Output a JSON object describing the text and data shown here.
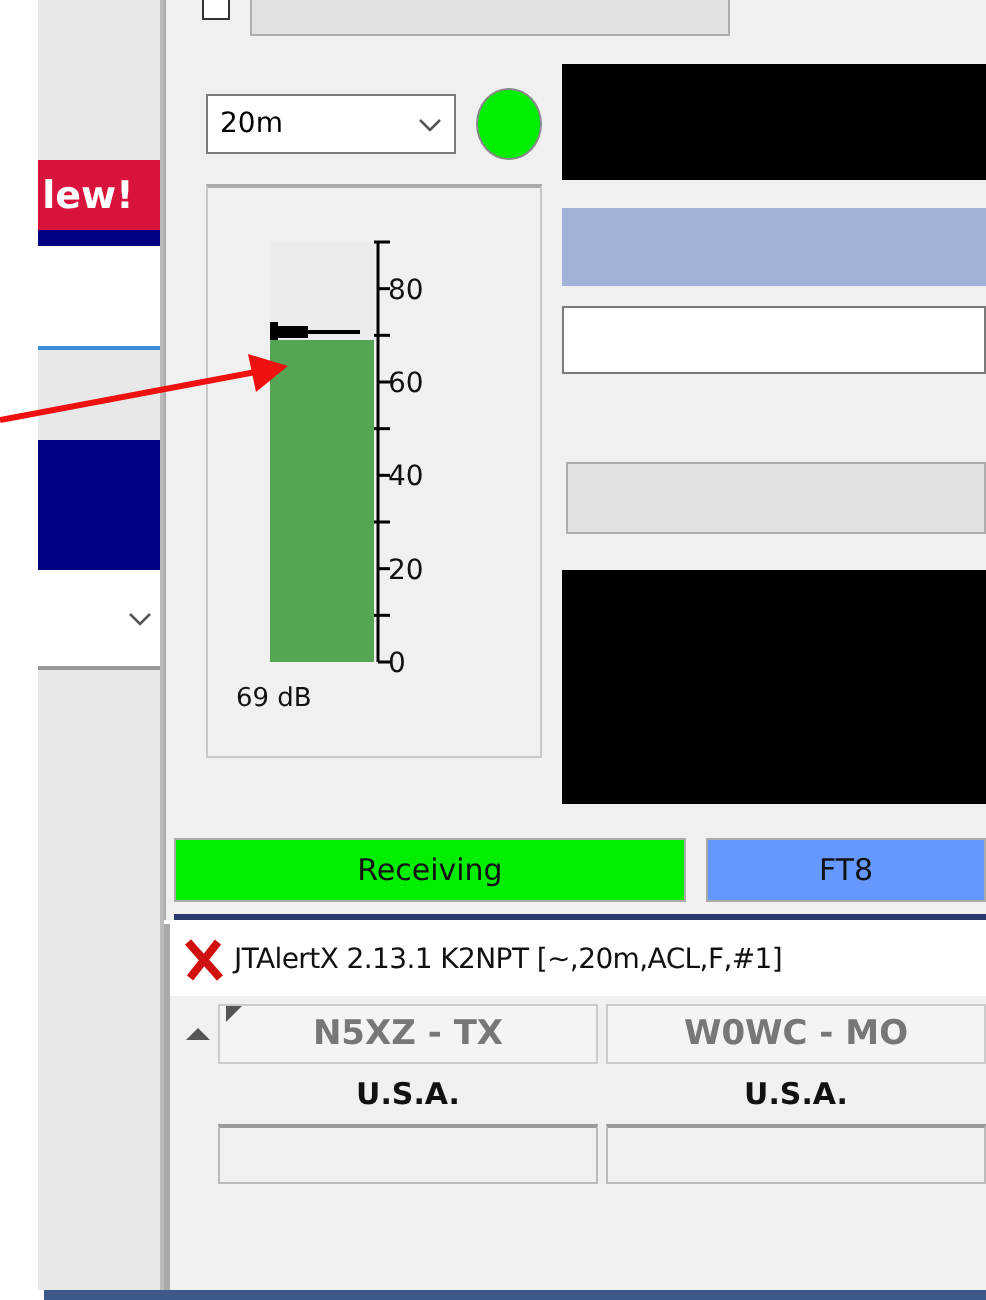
{
  "left_window": {
    "banner": "lew!"
  },
  "cq_only": {
    "checked": false
  },
  "band_select": {
    "value": "20m"
  },
  "meter": {
    "level": 0.767,
    "reading": "69 dB",
    "scale": [
      "80",
      "60",
      "40",
      "20",
      "0"
    ]
  },
  "status_bar": [
    {
      "label": "Receiving",
      "kind": "state"
    },
    {
      "label": "FT8",
      "kind": "mode"
    }
  ],
  "jtalert": {
    "title": "JTAlertX 2.13.1 K2NPT [~,20m,ACL,F,#1]",
    "callsigns": [
      {
        "call": "N5XZ - TX",
        "country": "U.S.A."
      },
      {
        "call": "W0WC - MO",
        "country": "U.S.A."
      }
    ]
  }
}
